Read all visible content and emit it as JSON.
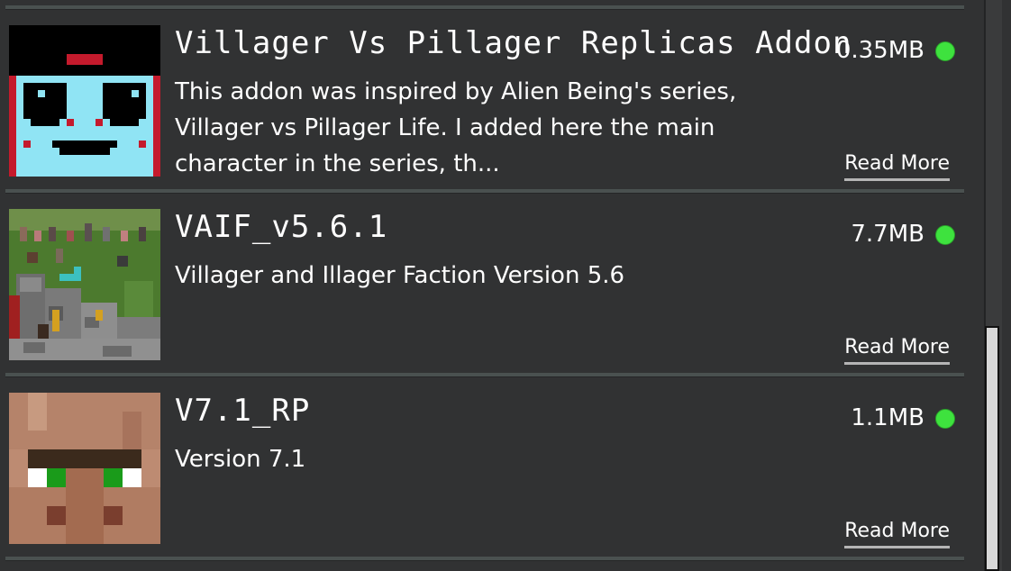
{
  "addons": [
    {
      "title": "Villager Vs Pillager Replicas Addon",
      "description": "This addon was inspired by Alien Being's series, Villager vs Pillager Life. I added here the main character in the series, th...",
      "size": "0.35MB",
      "status_color": "#3ee23e",
      "read_more": "Read More",
      "icon": "alien-face-icon"
    },
    {
      "title": "VAIF_v5.6.1",
      "description": "Villager and Illager Faction Version 5.6",
      "size": "7.7MB",
      "status_color": "#3ee23e",
      "read_more": "Read More",
      "icon": "minecraft-scene-thumbnail"
    },
    {
      "title": "V7.1_RP",
      "description": "Version 7.1",
      "size": "1.1MB",
      "status_color": "#3ee23e",
      "read_more": "Read More",
      "icon": "villager-face-icon"
    }
  ]
}
